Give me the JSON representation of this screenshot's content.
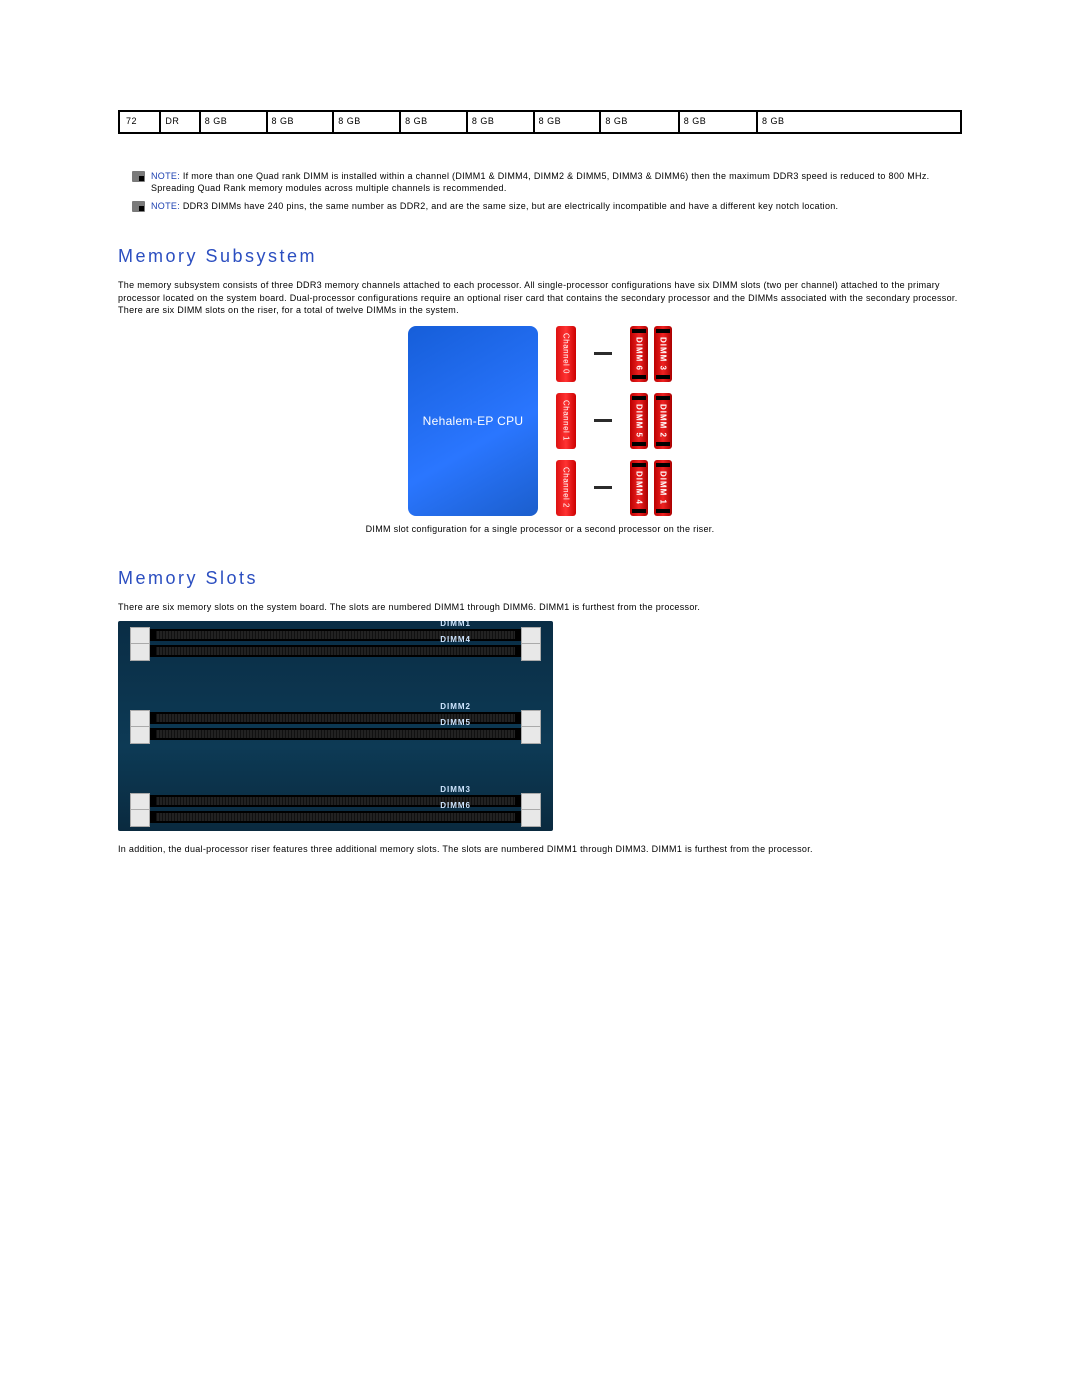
{
  "table_row": {
    "cells": [
      "72",
      "DR",
      "8 GB",
      "8 GB",
      "8 GB",
      "8 GB",
      "8 GB",
      "8 GB",
      "8 GB",
      "8 GB",
      "8 GB"
    ]
  },
  "notes": [
    {
      "label": "NOTE:",
      "text": " If more than one Quad rank DIMM is installed within a channel (DIMM1 & DIMM4, DIMM2 & DIMM5, DIMM3 & DIMM6) then the maximum DDR3 speed is reduced to 800 MHz. Spreading Quad Rank memory modules across multiple channels is recommended."
    },
    {
      "label": "NOTE:",
      "text": " DDR3 DIMMs have 240 pins, the same number as DDR2, and are the same size, but are electrically incompatible and have a different key notch location."
    }
  ],
  "h_subsystem": "Memory Subsystem",
  "p_subsystem": "The memory subsystem consists of three DDR3 memory channels attached to each processor. All single-processor configurations have six DIMM slots (two per channel) attached to the primary processor located on the system board. Dual-processor configurations require an optional riser card that contains the secondary processor and the DIMMs associated with the secondary processor. There are six DIMM slots on the riser, for a total of twelve DIMMs in the system.",
  "diagram1": {
    "cpu": "Nehalem-EP CPU",
    "channels": [
      "Channel 0",
      "Channel 1",
      "Channel 2"
    ],
    "dimms": [
      [
        "DIMM 6",
        "DIMM 3"
      ],
      [
        "DIMM 5",
        "DIMM 2"
      ],
      [
        "DIMM 4",
        "DIMM 1"
      ]
    ],
    "caption": "DIMM slot configuration for a single processor or a second processor on the riser."
  },
  "h_slots": "Memory Slots",
  "p_slots": "There are six memory slots on the system board. The slots are numbered DIMM1 through DIMM6. DIMM1 is furthest from the processor.",
  "slot_labels": [
    "DIMM1",
    "DIMM4",
    "DIMM2",
    "DIMM5",
    "DIMM3",
    "DIMM6"
  ],
  "p_riser": "In addition, the dual-processor riser features three additional memory slots. The slots are numbered DIMM1 through DIMM3. DIMM1 is furthest from the processor."
}
